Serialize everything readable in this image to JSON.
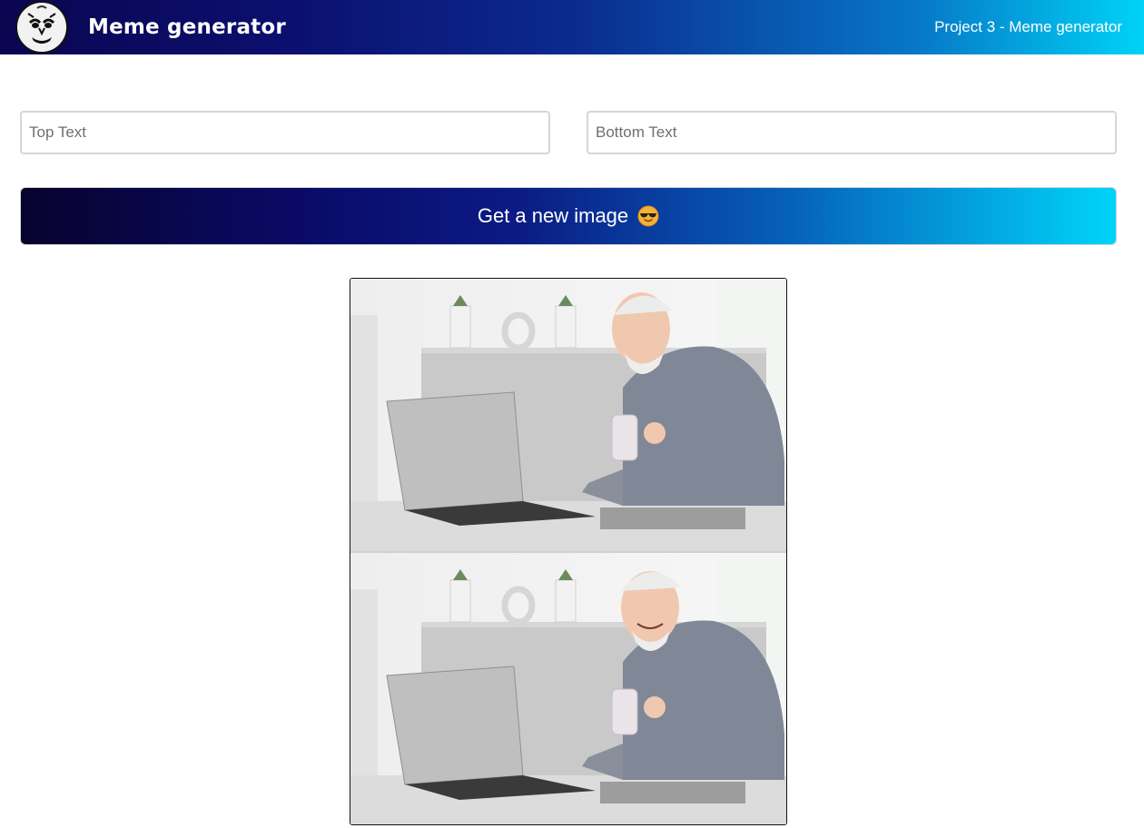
{
  "header": {
    "logo_icon": "meme-face-icon",
    "title": "Meme generator",
    "project_label": "Project 3 - Meme generator",
    "gradient_start": "#0a0550",
    "gradient_end": "#00d2f7"
  },
  "form": {
    "top_text": {
      "value": "",
      "placeholder": "Top Text"
    },
    "bottom_text": {
      "value": "",
      "placeholder": "Bottom Text"
    },
    "button": {
      "label": "Get a new image",
      "icon": "sunglasses-face-emoji"
    }
  },
  "meme": {
    "image_description_icon": "meme-image",
    "panels": [
      "top-panel",
      "bottom-panel"
    ]
  }
}
